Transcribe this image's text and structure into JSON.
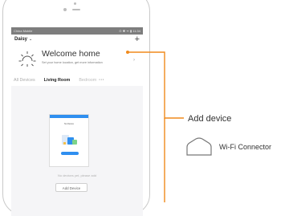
{
  "status_bar": {
    "carrier": "China Mobile",
    "right": "⊙ ✱ ᯤ ▮ 11:34"
  },
  "header": {
    "home_name": "Daisy",
    "chevron": "⌄",
    "plus": "+"
  },
  "welcome": {
    "title": "Welcome home",
    "subtitle": "Set your home location, get more information",
    "chevron": "›"
  },
  "tabs": {
    "items": [
      "All Devices",
      "Living Room",
      "Bedroom"
    ],
    "active": "Living Room",
    "more": "···"
  },
  "illustration": {
    "title": "No Device"
  },
  "empty_state": {
    "text": "No devices yet, please add",
    "button_label": "Add Device"
  },
  "callouts": {
    "add_device": "Add device",
    "connector": "Wi-Fi Connector",
    "line_color": "#f08a1c"
  },
  "icons": [
    "sun-icon",
    "plus-icon",
    "chevron-down-icon",
    "chevron-right-icon",
    "more-icon",
    "wifi-connector-icon"
  ]
}
